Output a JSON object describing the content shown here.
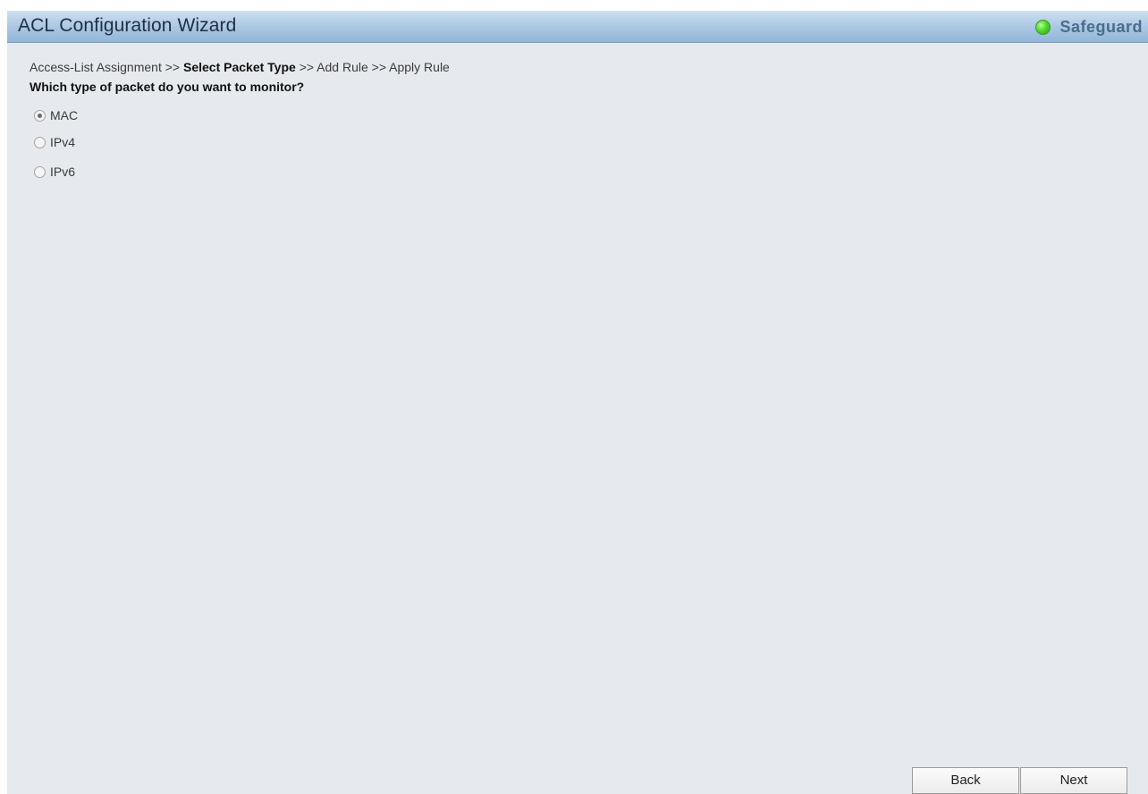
{
  "header": {
    "title": "ACL Configuration Wizard",
    "safeguard_label": "Safeguard",
    "safeguard_color": "#4fd82a"
  },
  "breadcrumb": {
    "step1": "Access-List Assignment",
    "sep1": ">>",
    "step2": "Select Packet Type",
    "sep2": ">>",
    "step3": "Add Rule",
    "sep3": ">>",
    "step4": "Apply Rule"
  },
  "question": "Which type of packet do you want to monitor?",
  "packet_types": [
    {
      "label": "MAC",
      "selected": true
    },
    {
      "label": "IPv4",
      "selected": false
    },
    {
      "label": "IPv6",
      "selected": false
    }
  ],
  "buttons": {
    "back": "Back",
    "next": "Next"
  }
}
